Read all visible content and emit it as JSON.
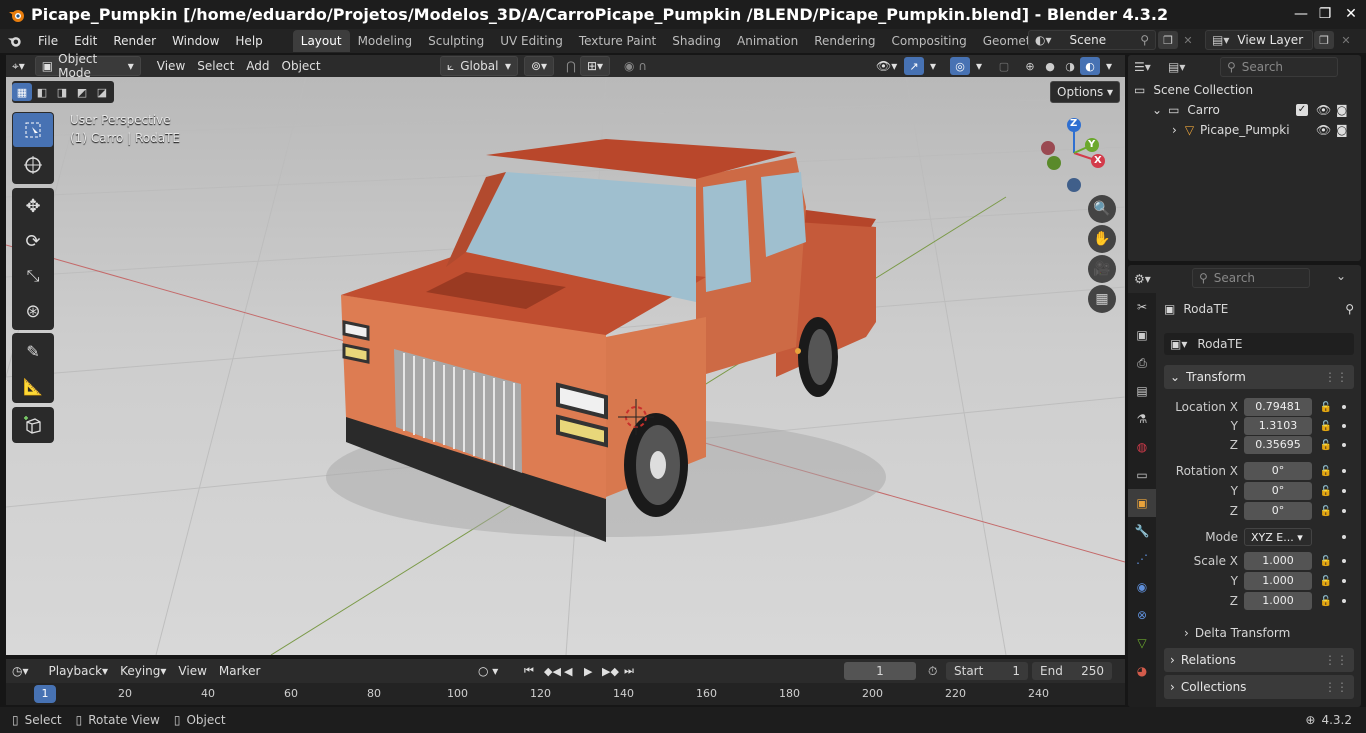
{
  "window": {
    "title": "Picape_Pumpkin [/home/eduardo/Projetos/Modelos_3D/A/CarroPicape_Pumpkin /BLEND/Picape_Pumpkin.blend] - Blender 4.3.2",
    "minimize": "—",
    "maximize": "❐",
    "close": "✕"
  },
  "menu": [
    "File",
    "Edit",
    "Render",
    "Window",
    "Help"
  ],
  "workspaces": [
    {
      "label": "Layout",
      "active": true
    },
    {
      "label": "Modeling"
    },
    {
      "label": "Sculpting"
    },
    {
      "label": "UV Editing"
    },
    {
      "label": "Texture Paint"
    },
    {
      "label": "Shading"
    },
    {
      "label": "Animation"
    },
    {
      "label": "Rendering"
    },
    {
      "label": "Compositing"
    },
    {
      "label": "Geometry Noc"
    }
  ],
  "scene": {
    "label": "Scene"
  },
  "view_layer": {
    "label": "View Layer"
  },
  "viewport_header": {
    "mode": "Object Mode",
    "menus": [
      "View",
      "Select",
      "Add",
      "Object"
    ],
    "transform_orientation": "Global",
    "options": "Options"
  },
  "viewport": {
    "perspective": "User Perspective",
    "context": "(1) Carro | RodaTE",
    "gizmo": {
      "x": "X",
      "y": "Y",
      "z": "Z"
    }
  },
  "outliner": {
    "search_placeholder": "Search",
    "scene_collection": "Scene Collection",
    "collection": "Carro",
    "object": "Picape_Pumpki"
  },
  "properties": {
    "search_placeholder": "Search",
    "object_name": "RodaTE",
    "object_field": "RodaTE",
    "transform_header": "Transform",
    "location": {
      "label_x": "Location X",
      "label_y": "Y",
      "label_z": "Z",
      "x": "0.79481",
      "y": "1.3103",
      "z": "0.35695"
    },
    "rotation": {
      "label_x": "Rotation X",
      "label_y": "Y",
      "label_z": "Z",
      "x": "0°",
      "y": "0°",
      "z": "0°"
    },
    "mode": {
      "label": "Mode",
      "value": "XYZ E..."
    },
    "scale": {
      "label_x": "Scale X",
      "label_y": "Y",
      "label_z": "Z",
      "x": "1.000",
      "y": "1.000",
      "z": "1.000"
    },
    "delta_transform": "Delta Transform",
    "relations": "Relations",
    "collections": "Collections"
  },
  "timeline": {
    "menus": [
      "Playback",
      "Keying",
      "View",
      "Marker"
    ],
    "current_frame": "1",
    "start_label": "Start",
    "start": "1",
    "end_label": "End",
    "end": "250",
    "frame_marker": "1",
    "ticks": [
      "20",
      "40",
      "60",
      "80",
      "100",
      "120",
      "140",
      "160",
      "180",
      "200",
      "220",
      "240"
    ]
  },
  "status": {
    "select": "Select",
    "rotate_view": "Rotate View",
    "object": "Object",
    "version": "4.3.2"
  },
  "colors": {
    "accent": "#4772b3",
    "car_body": "#d2744a",
    "car_dark": "#b4452a",
    "glass": "#9ab9c9",
    "floor": "#cfcfcf"
  }
}
